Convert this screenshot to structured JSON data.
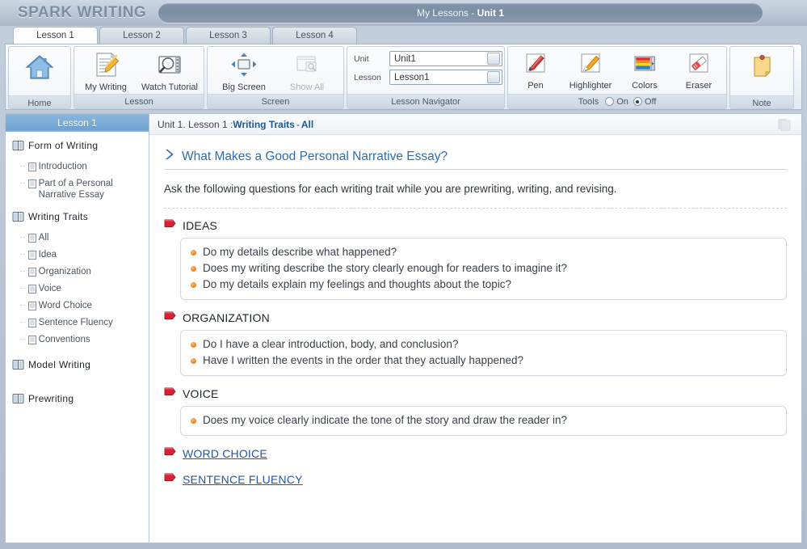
{
  "window": {
    "brand": "SPARK WRITING",
    "title_prefix": "My Lessons - ",
    "title_bold": "Unit 1"
  },
  "tabs": [
    {
      "label": "Lesson 1",
      "active": true
    },
    {
      "label": "Lesson 2",
      "active": false
    },
    {
      "label": "Lesson 3",
      "active": false
    },
    {
      "label": "Lesson 4",
      "active": false
    }
  ],
  "ribbon": {
    "home": {
      "group_label": "Home",
      "button": "",
      "icon": "home-icon"
    },
    "lesson": {
      "group_label": "Lesson",
      "my_writing": "My Writing",
      "watch_tutorial": "Watch Tutorial"
    },
    "screen": {
      "group_label": "Screen",
      "big_screen": "Big Screen",
      "show_all": "Show All"
    },
    "navigator": {
      "group_label": "Lesson Navigator",
      "unit_label": "Unit",
      "unit_value": "Unit1",
      "lesson_label": "Lesson",
      "lesson_value": "Lesson1"
    },
    "tools": {
      "group_label": "Tools",
      "pen": "Pen",
      "highlighter": "Highlighter",
      "colors": "Colors",
      "eraser": "Eraser",
      "on_label": "On",
      "off_label": "Off",
      "selected": "Off"
    },
    "note": {
      "group_label": "Note"
    }
  },
  "sidebar": {
    "header": "Lesson 1",
    "sections": [
      {
        "title": "Form of Writing",
        "items": [
          "Introduction",
          "Part of a Personal Narrative Essay"
        ]
      },
      {
        "title": "Writing Traits",
        "items": [
          "All",
          "Idea",
          "Organization",
          "Voice",
          "Word Choice",
          "Sentence Fluency",
          "Conventions"
        ]
      },
      {
        "title": "Model Writing",
        "items": []
      },
      {
        "title": "Prewriting",
        "items": []
      }
    ]
  },
  "breadcrumb": {
    "plain": "Unit 1. Lesson 1 : ",
    "section": "Writing Traits",
    "dash": " - ",
    "item": "All"
  },
  "content": {
    "heading": "What Makes a Good Personal Narrative Essay?",
    "intro": "Ask the following questions for each writing trait while you are prewriting, writing, and revising.",
    "traits": [
      {
        "name": "IDEAS",
        "is_link": false,
        "questions": [
          "Do my details describe what happened?",
          "Does my writing describe the story clearly enough for readers to imagine it?",
          "Do my details explain my feelings and thoughts about the topic?"
        ]
      },
      {
        "name": "ORGANIZATION",
        "is_link": false,
        "questions": [
          "Do I have a clear introduction, body, and conclusion?",
          "Have I written the events in the order that they actually happened?"
        ]
      },
      {
        "name": "VOICE",
        "is_link": false,
        "questions": [
          "Does my voice clearly indicate the tone of the story and draw the reader in?"
        ]
      },
      {
        "name": "WORD CHOICE",
        "is_link": true,
        "questions": []
      },
      {
        "name": "SENTENCE FLUENCY",
        "is_link": true,
        "questions": []
      }
    ]
  },
  "colors": {
    "brand_text": "#7d8ea3",
    "accent_blue": "#2d6fae",
    "link_blue": "#2456a6",
    "sidebar_header": "#6ea4d3",
    "pennant_red": "#cf2233",
    "bullet_orange": "#f08a24"
  }
}
